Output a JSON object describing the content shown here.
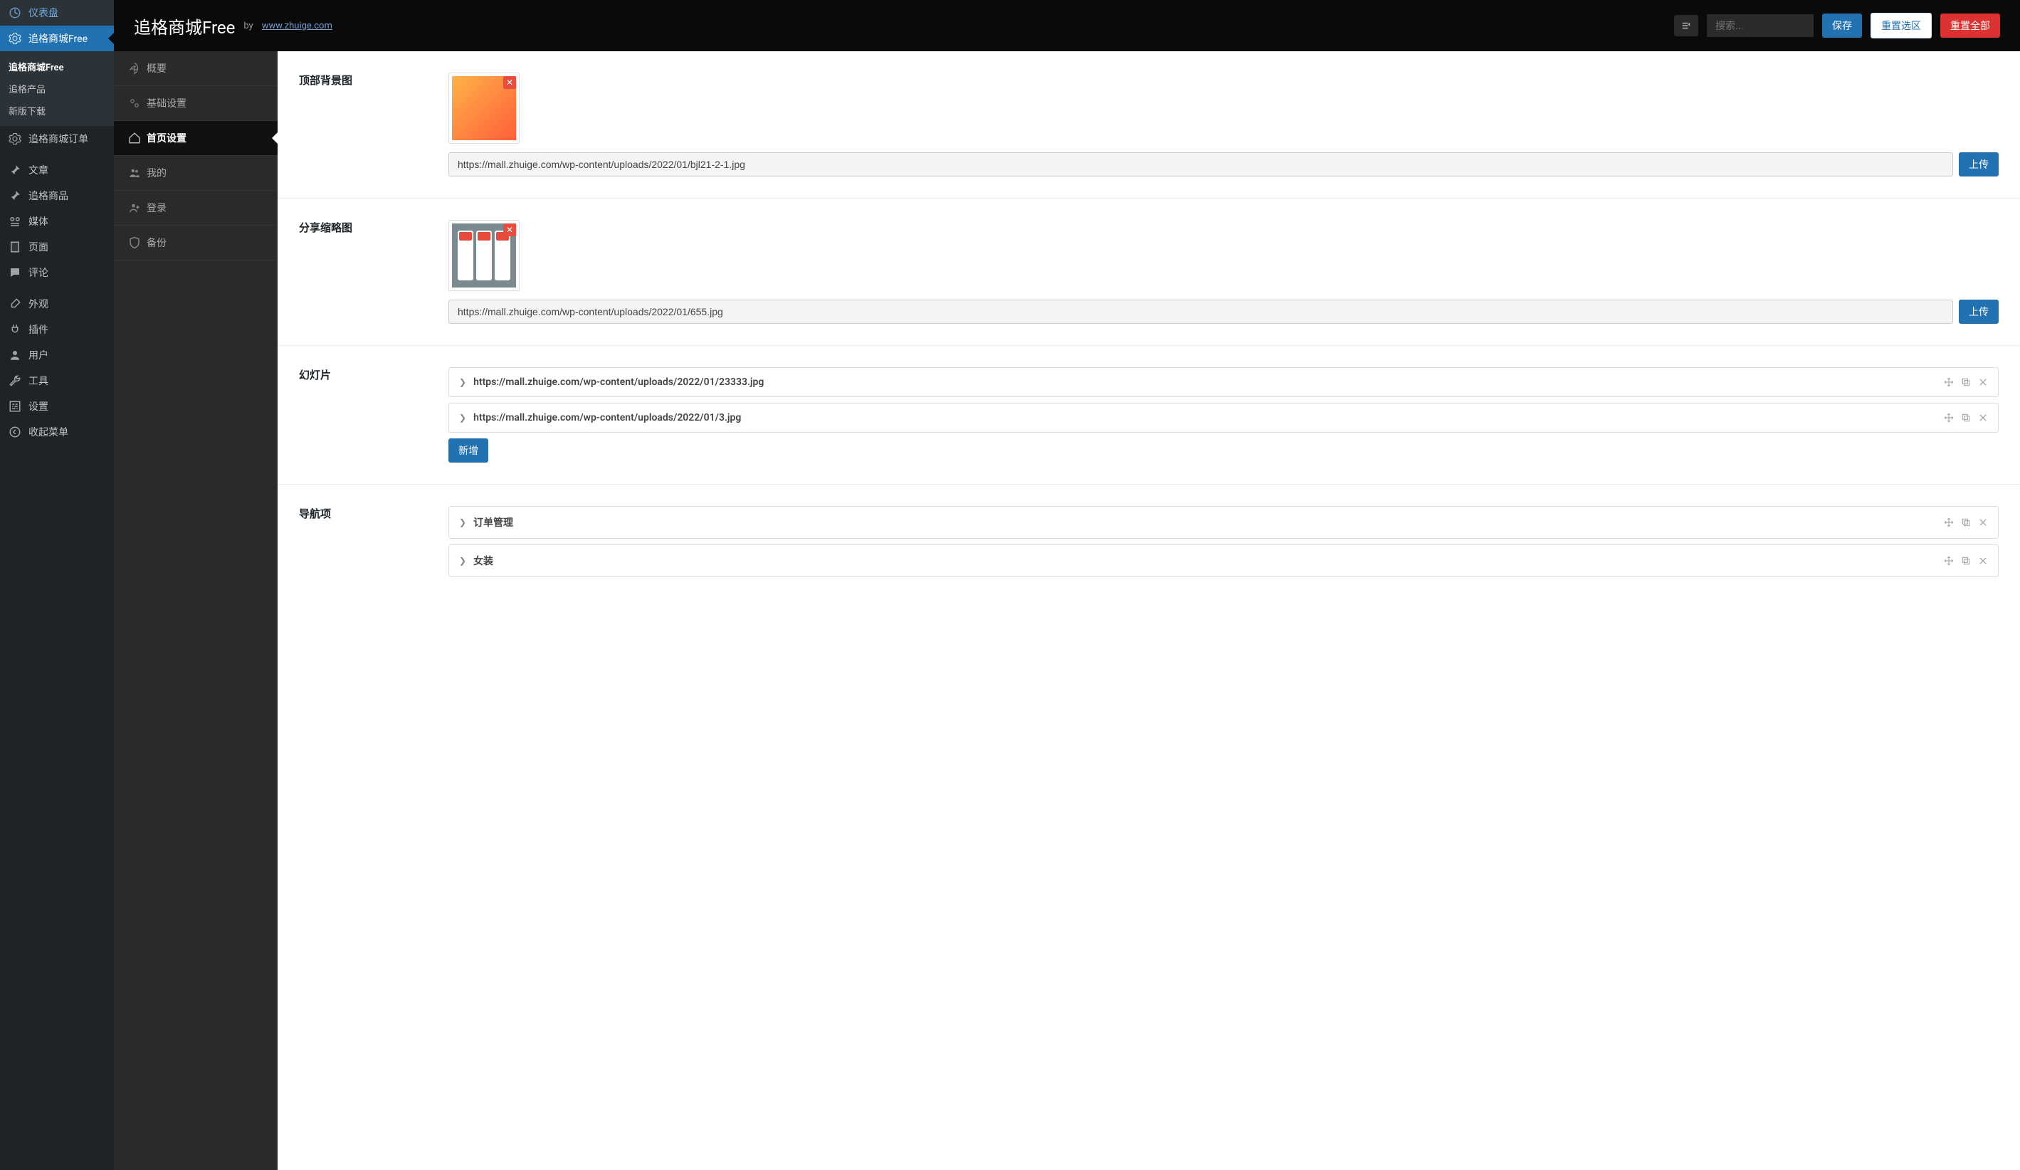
{
  "wp_sidebar": {
    "items": [
      {
        "id": "dashboard",
        "label": "仪表盘",
        "icon": "dashboard"
      },
      {
        "id": "zhuige-free",
        "label": "追格商城Free",
        "icon": "gear",
        "current": true,
        "sub": [
          {
            "label": "追格商城Free",
            "active": true
          },
          {
            "label": "追格产品"
          },
          {
            "label": "新版下载"
          }
        ]
      },
      {
        "id": "orders",
        "label": "追格商城订单",
        "icon": "gear"
      },
      {
        "sep": true
      },
      {
        "id": "posts",
        "label": "文章",
        "icon": "pin"
      },
      {
        "id": "goods",
        "label": "追格商品",
        "icon": "pin"
      },
      {
        "id": "media",
        "label": "媒体",
        "icon": "media"
      },
      {
        "id": "pages",
        "label": "页面",
        "icon": "page"
      },
      {
        "id": "comments",
        "label": "评论",
        "icon": "comment"
      },
      {
        "sep": true
      },
      {
        "id": "appearance",
        "label": "外观",
        "icon": "brush"
      },
      {
        "id": "plugins",
        "label": "插件",
        "icon": "plug"
      },
      {
        "id": "users",
        "label": "用户",
        "icon": "user"
      },
      {
        "id": "tools",
        "label": "工具",
        "icon": "wrench"
      },
      {
        "id": "settings",
        "label": "设置",
        "icon": "sliders"
      },
      {
        "id": "collapse",
        "label": "收起菜单",
        "icon": "collapse"
      }
    ]
  },
  "topbar": {
    "title": "追格商城Free",
    "by_label": "by",
    "link_text": "www.zhuige.com",
    "search_placeholder": "搜索...",
    "save": "保存",
    "reset_section": "重置选区",
    "reset_all": "重置全部"
  },
  "tabs": [
    {
      "id": "overview",
      "label": "概要",
      "icon": "rocket"
    },
    {
      "id": "basic",
      "label": "基础设置",
      "icon": "cogs"
    },
    {
      "id": "home",
      "label": "首页设置",
      "icon": "home",
      "active": true
    },
    {
      "id": "my",
      "label": "我的",
      "icon": "users"
    },
    {
      "id": "login",
      "label": "登录",
      "icon": "user-plus"
    },
    {
      "id": "backup",
      "label": "备份",
      "icon": "shield"
    }
  ],
  "fields": {
    "top_bg": {
      "label": "顶部背景图",
      "url": "https://mall.zhuige.com/wp-content/uploads/2022/01/bjl21-2-1.jpg",
      "upload": "上传"
    },
    "share_thumb": {
      "label": "分享缩略图",
      "url": "https://mall.zhuige.com/wp-content/uploads/2022/01/655.jpg",
      "upload": "上传"
    },
    "slides": {
      "label": "幻灯片",
      "items": [
        "https://mall.zhuige.com/wp-content/uploads/2022/01/23333.jpg",
        "https://mall.zhuige.com/wp-content/uploads/2022/01/3.jpg"
      ],
      "add": "新增"
    },
    "nav": {
      "label": "导航项",
      "items": [
        "订单管理",
        "女装"
      ]
    }
  },
  "icons": {
    "dashboard": "◔",
    "gear": "⚙",
    "pin": "📌",
    "media": "🎛",
    "page": "▤",
    "comment": "💬",
    "brush": "🖌",
    "plug": "🔌",
    "user": "👤",
    "wrench": "🔧",
    "sliders": "▦",
    "collapse": "◀",
    "rocket": "🚀",
    "cogs": "⚙",
    "home": "🏠",
    "users": "👥",
    "user-plus": "👤",
    "shield": "🛡"
  }
}
